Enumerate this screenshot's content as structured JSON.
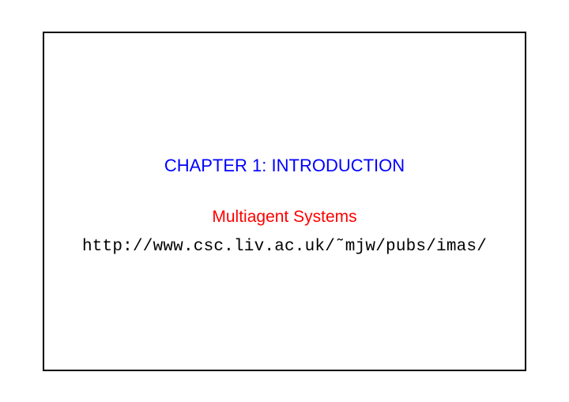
{
  "slide": {
    "chapter_title": "CHAPTER 1: INTRODUCTION",
    "subtitle": "Multiagent Systems",
    "url": "http://www.csc.liv.ac.uk/˜mjw/pubs/imas/"
  }
}
